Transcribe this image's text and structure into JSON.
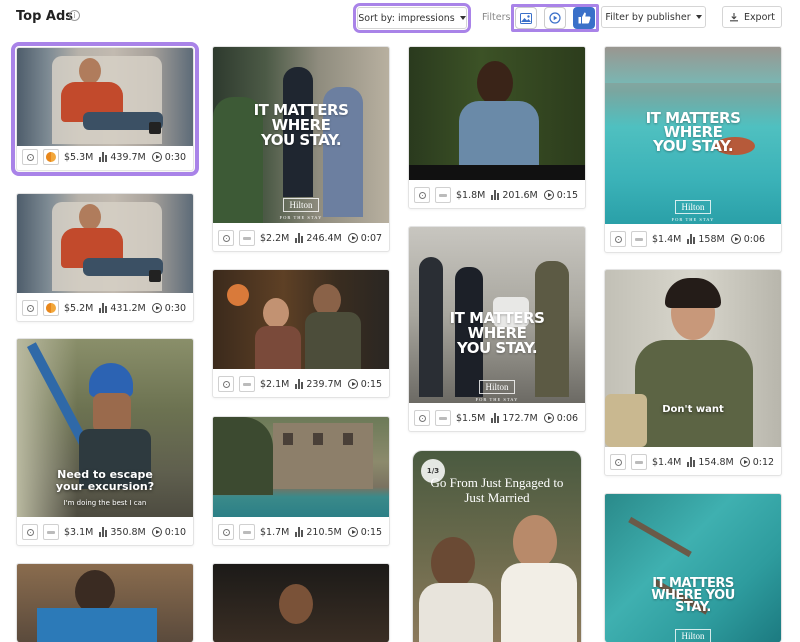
{
  "header": {
    "title": "Top Ads",
    "sort_label": "Sort by: impressions",
    "filters_label": "Filters:",
    "publisher_label": "Filter by publisher",
    "export_label": "Export"
  },
  "colors": {
    "highlight": "#a983e8",
    "active_filter": "#3a70c9"
  },
  "cards": [
    {
      "spend": "$5.3M",
      "impressions": "439.7M",
      "duration": "0:30"
    },
    {
      "spend": "$5.2M",
      "impressions": "431.2M",
      "duration": "0:30"
    },
    {
      "spend": "$3.1M",
      "impressions": "350.8M",
      "duration": "0:10",
      "caption": "Need to escape your excursion?",
      "subcaption": "I'm doing the best I can"
    },
    {
      "spend": "$2.2M",
      "impressions": "246.4M",
      "duration": "0:07",
      "overlay": "IT MATTERS WHERE YOU STAY.",
      "brand": "Hilton",
      "brand_sub": "FOR THE STAY"
    },
    {
      "spend": "$2.1M",
      "impressions": "239.7M",
      "duration": "0:15"
    },
    {
      "spend": "$1.7M",
      "impressions": "210.5M",
      "duration": "0:15"
    },
    {
      "spend": "$1.8M",
      "impressions": "201.6M",
      "duration": "0:15"
    },
    {
      "spend": "$1.5M",
      "impressions": "172.7M",
      "duration": "0:06",
      "overlay": "IT MATTERS WHERE YOU STAY.",
      "brand": "Hilton",
      "brand_sub": "FOR THE STAY"
    },
    {
      "badge": "1/3",
      "headline": "Go From Just Engaged to Just Married"
    },
    {
      "spend": "$1.4M",
      "impressions": "158M",
      "duration": "0:06",
      "overlay": "IT MATTERS WHERE YOU STAY.",
      "brand": "Hilton",
      "brand_sub": "FOR THE STAY"
    },
    {
      "spend": "$1.4M",
      "impressions": "154.8M",
      "duration": "0:12",
      "caption": "Don't want"
    },
    {
      "overlay": "IT MATTERS WHERE YOU STAY.",
      "brand": "Hilton"
    }
  ]
}
